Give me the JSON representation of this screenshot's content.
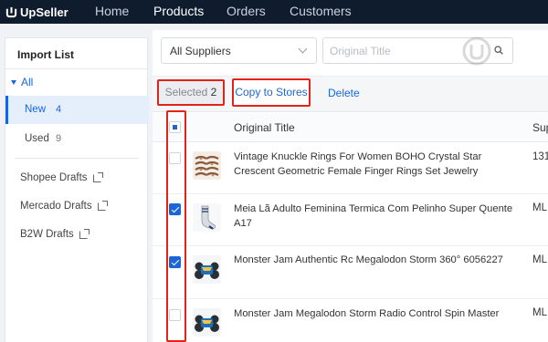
{
  "nav": {
    "logo": "UpSeller",
    "items": [
      {
        "label": "Home",
        "active": false
      },
      {
        "label": "Products",
        "active": true
      },
      {
        "label": "Orders",
        "active": false
      },
      {
        "label": "Customers",
        "active": false
      }
    ]
  },
  "sidebar": {
    "title": "Import List",
    "all_label": "All",
    "status_items": [
      {
        "label": "New",
        "count": "4",
        "active": true
      },
      {
        "label": "Used",
        "count": "9",
        "active": false
      }
    ],
    "drafts": [
      "Shopee Drafts",
      "Mercado Drafts",
      "B2W Drafts"
    ]
  },
  "filters": {
    "supplier": "All Suppliers",
    "search_placeholder": "Original Title"
  },
  "actions": {
    "selected_label": "Selected",
    "selected_count": "2",
    "copy_label": "Copy to Stores",
    "delete_label": "Delete"
  },
  "table": {
    "columns": [
      "Original Title",
      "Sup"
    ],
    "rows": [
      {
        "title": "Vintage Knuckle Rings For Women BOHO Crystal Star Crescent Geometric Female Finger Rings Set Jewelry",
        "supplier": "131",
        "checked": false,
        "thumb": "rings-thumbnail"
      },
      {
        "title": "Meia Lã Adulto Feminina Termica Com Pelinho Super Quente A17",
        "supplier": "MLI",
        "checked": true,
        "thumb": "socks-thumbnail"
      },
      {
        "title": "Monster Jam Authentic Rc Megalodon Storm 360° 6056227",
        "supplier": "MLI",
        "checked": true,
        "thumb": "rc-truck-thumbnail"
      },
      {
        "title": "Monster Jam Megalodon Storm Radio Control Spin Master",
        "supplier": "MLI",
        "checked": false,
        "thumb": "rc-truck-thumbnail"
      }
    ]
  },
  "colors": {
    "nav_bg": "#0f1c2e",
    "accent": "#1a66d8",
    "highlight": "#e2231a"
  }
}
